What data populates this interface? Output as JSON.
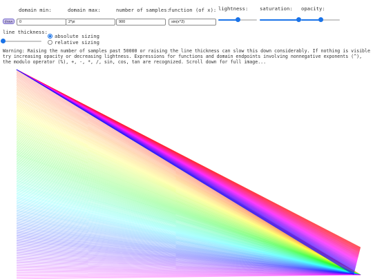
{
  "controls": {
    "domain_min": {
      "label": "domain min:",
      "value": "0"
    },
    "domain_max": {
      "label": "domain max:",
      "value": "2*pi"
    },
    "samples": {
      "label": "number of samples:",
      "value": "900"
    },
    "function": {
      "label": "function (of x):",
      "value": "sin(x^2)"
    },
    "draw_button": "draw",
    "lightness": {
      "label": "lightness:",
      "level": 0.5
    },
    "saturation": {
      "label": "saturation:",
      "level": 1.0
    },
    "opacity": {
      "label": "opacity:",
      "level": 0.5
    },
    "line_thickness": {
      "label": "line thickness:",
      "level": 0.0,
      "options": [
        "absolute sizing",
        "relative sizing"
      ],
      "selected": "absolute sizing"
    }
  },
  "warning": "Warning: Raising the number of samples past 50000 or raising the line thickness can slow this down considerably. If nothing is visible try increasing opacity or decreasing lightness. Expressions for functions and domain endpoints involving nonnegative exponents (^), the modulo operator (%), +, -, *, /, sin, cos, tan are recognized. Scroll down for full image...",
  "colors": {
    "accent": "#1a73e8",
    "button_bg": "#d6cdf2",
    "button_border": "#6c5fc4"
  }
}
